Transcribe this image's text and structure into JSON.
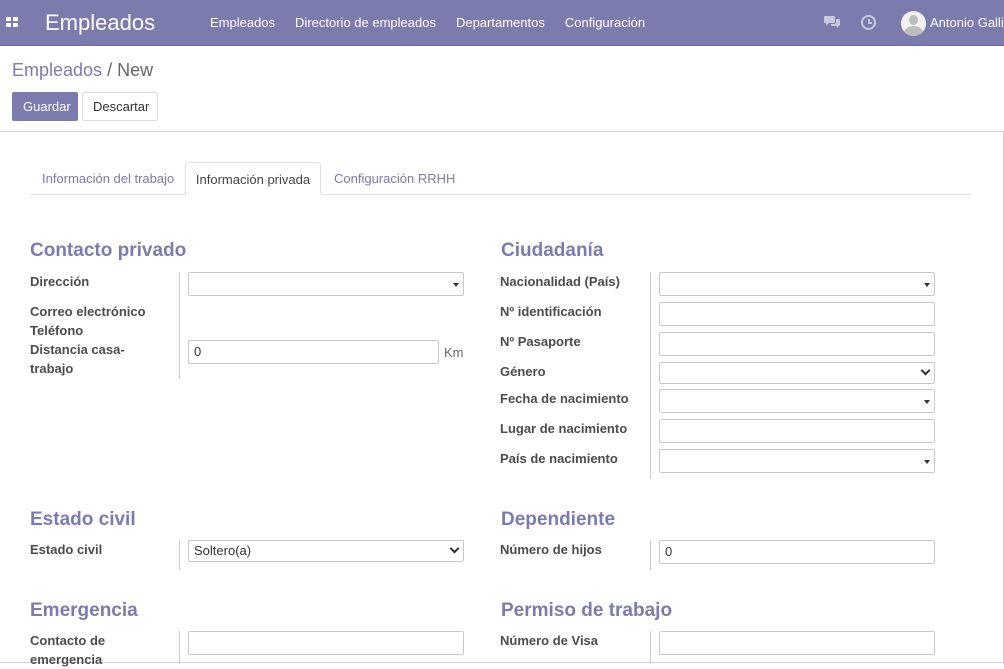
{
  "navbar": {
    "app_title": "Empleados",
    "menu": [
      "Empleados",
      "Directorio de empleados",
      "Departamentos",
      "Configuración"
    ],
    "user_name": "Antonio Galli"
  },
  "breadcrumb": {
    "parent": "Empleados",
    "separator": " / ",
    "current": "New"
  },
  "buttons": {
    "save": "Guardar",
    "discard": "Descartar"
  },
  "tabs": [
    "Información del trabajo",
    "Información privada",
    "Configuración RRHH"
  ],
  "private_contact": {
    "title": "Contacto privado",
    "address_label": "Dirección",
    "address_value": "",
    "email_label": "Correo electrónico",
    "phone_label": "Teléfono",
    "distance_label_1": "Distancia casa-",
    "distance_label_2": "trabajo",
    "distance_value": "0",
    "distance_unit": "Km"
  },
  "citizenship": {
    "title": "Ciudadanía",
    "nationality_label": "Nacionalidad (País)",
    "id_label": "Nº identificación",
    "passport_label": "Nº Pasaporte",
    "gender_label": "Género",
    "birthdate_label": "Fecha de nacimiento",
    "birthplace_label": "Lugar de nacimiento",
    "birth_country_label": "País de nacimiento"
  },
  "marital": {
    "title": "Estado civil",
    "label": "Estado civil",
    "value": "Soltero(a)"
  },
  "dependants": {
    "title": "Dependiente",
    "children_label": "Número de hijos",
    "children_value": "0"
  },
  "emergency": {
    "title": "Emergencia",
    "contact_label_1": "Contacto de",
    "contact_label_2": "emergencia"
  },
  "work_permit": {
    "title": "Permiso de trabajo",
    "visa_label": "Número de Visa"
  }
}
